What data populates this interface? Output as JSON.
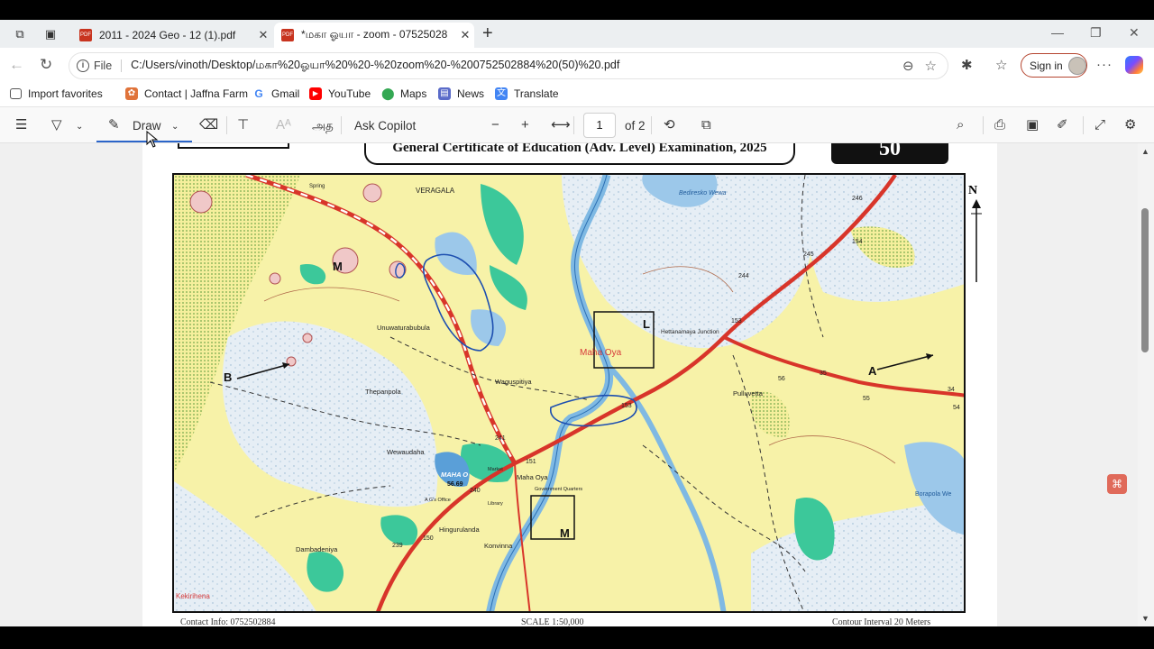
{
  "tabs": [
    {
      "title": "2011 - 2024 Geo - 12 (1).pdf",
      "icon": "pdf-icon"
    },
    {
      "title": "*மகா ஓயா - zoom - 07525028",
      "icon": "pdf-icon"
    }
  ],
  "address": {
    "chip": "File",
    "url": "C:/Users/vinoth/Desktop/மகா%20ஓயா%20%20-%20zoom%20-%200752502884%20(50)%20.pdf"
  },
  "signin": {
    "label": "Sign in"
  },
  "favorites": [
    {
      "label": "Import favorites",
      "icon": "import-icon",
      "color": "#555555"
    },
    {
      "label": "Contact | Jaffna Farm",
      "icon": "jaffna-farm-icon",
      "color": "#e0733a"
    },
    {
      "label": "Gmail",
      "icon": "google-icon",
      "color": "#4285f4"
    },
    {
      "label": "YouTube",
      "icon": "youtube-icon",
      "color": "#ff0000"
    },
    {
      "label": "Maps",
      "icon": "maps-icon",
      "color": "#34a853"
    },
    {
      "label": "News",
      "icon": "news-icon",
      "color": "#5a6bc9"
    },
    {
      "label": "Translate",
      "icon": "translate-icon",
      "color": "#4285f4"
    }
  ],
  "pdf_toolbar": {
    "draw_label": "Draw",
    "read_aloud_glyph": "அத",
    "ask_copilot": "Ask Copilot",
    "page_value": "1",
    "page_total": "of 2"
  },
  "document": {
    "exam_title": "General Certificate of Education (Adv. Level) Examination, 2025",
    "paper_number": "50",
    "north_label": "N",
    "footer_left": "Contact Info: 0752502884",
    "footer_mid": "SCALE 1:50,000",
    "footer_right": "Contour Interval 20 Meters"
  },
  "map": {
    "labels": {
      "veragala": "VERAGALA",
      "spring": "Spring",
      "bediresko_wewa": "Bediresko Wewa",
      "unuwaturabubula": "Unuwaturabubula",
      "maha_oya_river": "Maha Oya",
      "hettanamaya_junction": "Hettanamaya Junction",
      "thepanpola": "Thepanpola",
      "waguspitiya": "Waguspitiya",
      "pulluvetta": "Pulluvetta",
      "wewaudaha": "Wewaudaha",
      "maha_oya_tank": "MAHA O",
      "tank_level": "56.69",
      "maha_oya_town": "Maha Oya",
      "hingurulanda": "Hingurulanda",
      "konvinna": "Konvinna",
      "dambadeniya": "Dambadeniya",
      "kekirihena": "Kekirihena",
      "borapola_wewa": "Borapola We",
      "ags_office": "A G's Office",
      "library": "Library",
      "government_quarters": "Government Quarters",
      "market": "Market"
    },
    "markers": {
      "A": "A",
      "B": "B",
      "L": "L",
      "M_top": "M",
      "M_box": "M"
    },
    "spot_heights": [
      "246",
      "154",
      "245",
      "244",
      "153",
      "35",
      "56",
      "55",
      "54",
      "34",
      "241",
      "151",
      "240",
      "239",
      "150",
      "153"
    ]
  }
}
